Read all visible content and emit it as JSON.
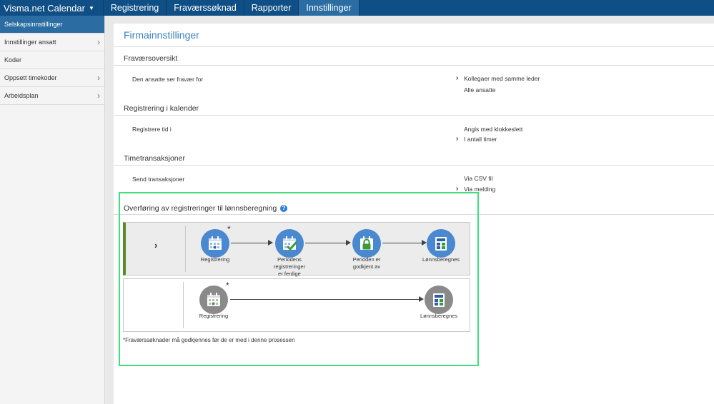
{
  "topbar": {
    "brand": "Visma.net Calendar",
    "tabs": [
      {
        "label": "Registrering"
      },
      {
        "label": "Fraværssøknad"
      },
      {
        "label": "Rapporter"
      },
      {
        "label": "Innstillinger",
        "active": true
      }
    ]
  },
  "sidebar": {
    "items": [
      {
        "label": "Selskapsinnstillinger",
        "active": true
      },
      {
        "label": "Innstillinger ansatt",
        "has_children": true
      },
      {
        "label": "Koder"
      },
      {
        "label": "Oppsett timekoder",
        "has_children": true
      },
      {
        "label": "Arbeidsplan",
        "has_children": true
      }
    ]
  },
  "main": {
    "title": "Firmainnstillinger",
    "sections": {
      "fravaer": {
        "heading": "Fraværsoversikt",
        "row_label": "Den ansatte ser fravær for",
        "options": [
          "Kollegaer med samme leder",
          "Alle ansatte"
        ],
        "selected": 0
      },
      "registrering": {
        "heading": "Registrering i kalender",
        "row_label": "Registrere tid i",
        "options": [
          "Angis med klokkeslett",
          "I antall timer"
        ],
        "selected": 1
      },
      "timetrans": {
        "heading": "Timetransaksjoner",
        "row_label": "Send transaksjoner",
        "options": [
          "Via CSV fil",
          "Via melding"
        ],
        "selected": 1
      },
      "overforing": {
        "heading": "Overføring av registreringer til lønnsberegning",
        "help": "?"
      }
    },
    "flow1": {
      "steps": [
        {
          "label": "Registrering",
          "icon": "calendar-icon"
        },
        {
          "label_line1": "Periodens registreringer",
          "label_line2": "er ferdige",
          "icon": "calendar-check-icon"
        },
        {
          "label_line1": "Perioden er",
          "label_line2": "godkjent av",
          "icon": "lock-icon"
        },
        {
          "label": "Lønnsberegnes",
          "icon": "calculator-icon"
        }
      ],
      "asterisk": "*"
    },
    "flow2": {
      "steps": [
        {
          "label": "Registrering",
          "icon": "calendar-icon"
        },
        {
          "label": "Lønnsberegnes",
          "icon": "calculator-icon"
        }
      ],
      "asterisk": "*"
    },
    "footnote": "*Fraværssøknader må godkjennes før de er med i denne prosessen"
  },
  "colors": {
    "topbar": "#0f4f85",
    "accent": "#2b6da3",
    "step_blue": "#4a88d0",
    "step_grey": "#8a8a8a",
    "selected_flow_marker": "#5a8d29",
    "highlight": "#3fe07c"
  }
}
